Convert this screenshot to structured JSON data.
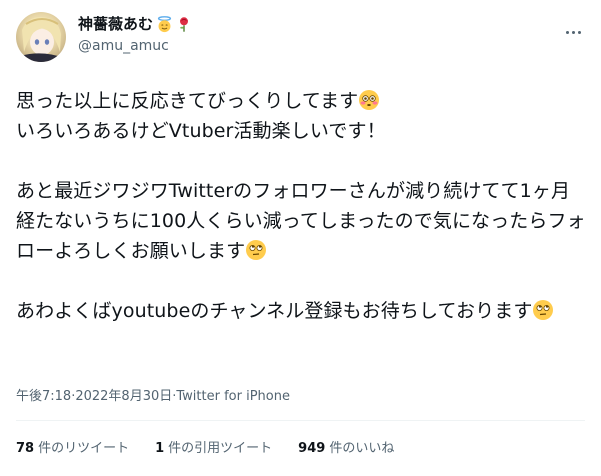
{
  "author": {
    "display_name": "神薔薇あむ",
    "handle": "@amu_amuc"
  },
  "body": {
    "line1": "思った以上に反応きてびっくりしてます",
    "line2": "いろいろあるけどVtuber活動楽しいです！",
    "line3": "あと最近ジワジワTwitterのフォロワーさんが減り続けてて1ヶ月経たないうちに100人くらい減ってしまったので気になったらフォローよろしくお願いします",
    "line4": "あわよくばyoutubeのチャンネル登録もお待ちしております"
  },
  "meta": {
    "time": "午後7:18",
    "sep1": " · ",
    "date": "2022年8月30日",
    "sep2": " · ",
    "source": "Twitter for iPhone"
  },
  "stats": {
    "retweets_count": "78",
    "retweets_label": "件のリツイート",
    "quotes_count": "1",
    "quotes_label": "件の引用ツイート",
    "likes_count": "949",
    "likes_label": "件のいいね"
  },
  "icons": {
    "name_emoji_1": "smiling-face-with-halo-icon",
    "name_emoji_2": "rose-icon",
    "flushed": "flushed-face-icon",
    "eye_roll": "face-with-rolling-eyes-icon",
    "more": "more-icon"
  },
  "colors": {
    "text": "#0f1419",
    "secondary": "#536471",
    "divider": "#eff3f4"
  }
}
